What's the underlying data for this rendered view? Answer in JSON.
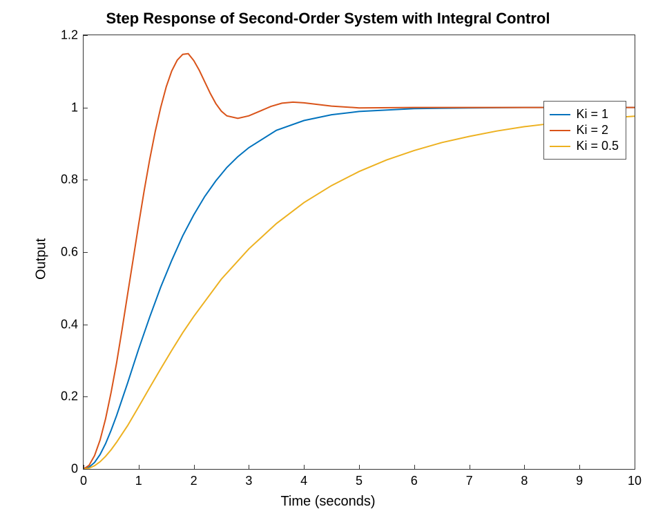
{
  "chart_data": {
    "type": "line",
    "title": "Step Response of Second-Order System with Integral Control",
    "xlabel": "Time (seconds)",
    "ylabel": "Output",
    "xlim": [
      0,
      10
    ],
    "ylim": [
      0,
      1.2
    ],
    "xticks": [
      0,
      1,
      2,
      3,
      4,
      5,
      6,
      7,
      8,
      9,
      10
    ],
    "yticks": [
      0,
      0.2,
      0.4,
      0.6,
      0.8,
      1,
      1.2
    ],
    "legend_position": "upper-right",
    "series": [
      {
        "name": "Ki = 1",
        "color": "#0072BD",
        "x": [
          0,
          0.1,
          0.2,
          0.3,
          0.4,
          0.5,
          0.6,
          0.7,
          0.8,
          0.9,
          1.0,
          1.2,
          1.4,
          1.6,
          1.8,
          2.0,
          2.2,
          2.4,
          2.6,
          2.8,
          3.0,
          3.5,
          4.0,
          4.5,
          5.0,
          6.0,
          7.0,
          8.0,
          9.0,
          10.0
        ],
        "y": [
          0,
          0.005,
          0.018,
          0.04,
          0.07,
          0.107,
          0.148,
          0.193,
          0.238,
          0.285,
          0.332,
          0.42,
          0.503,
          0.577,
          0.645,
          0.703,
          0.754,
          0.797,
          0.834,
          0.864,
          0.889,
          0.937,
          0.964,
          0.98,
          0.989,
          0.997,
          0.999,
          1.0,
          1.0,
          1.0
        ]
      },
      {
        "name": "Ki = 2",
        "color": "#D95319",
        "x": [
          0,
          0.1,
          0.2,
          0.3,
          0.4,
          0.5,
          0.6,
          0.7,
          0.8,
          0.9,
          1.0,
          1.1,
          1.2,
          1.3,
          1.4,
          1.5,
          1.6,
          1.7,
          1.8,
          1.9,
          2.0,
          2.1,
          2.2,
          2.3,
          2.4,
          2.5,
          2.6,
          2.8,
          3.0,
          3.2,
          3.4,
          3.6,
          3.8,
          4.0,
          4.5,
          5.0,
          6.0,
          7.0,
          8.0,
          9.0,
          10.0
        ],
        "y": [
          0,
          0.01,
          0.037,
          0.08,
          0.139,
          0.212,
          0.294,
          0.387,
          0.484,
          0.58,
          0.677,
          0.77,
          0.856,
          0.933,
          1.0,
          1.057,
          1.101,
          1.131,
          1.147,
          1.149,
          1.13,
          1.103,
          1.071,
          1.039,
          1.011,
          0.99,
          0.977,
          0.97,
          0.977,
          0.99,
          1.003,
          1.012,
          1.015,
          1.013,
          1.004,
          0.999,
          1.0,
          1.0,
          1.0,
          1.0,
          1.0
        ]
      },
      {
        "name": "Ki = 0.5",
        "color": "#EDB120",
        "x": [
          0,
          0.1,
          0.2,
          0.3,
          0.4,
          0.5,
          0.6,
          0.8,
          1.0,
          1.2,
          1.4,
          1.6,
          1.8,
          2.0,
          2.5,
          3.0,
          3.5,
          4.0,
          4.5,
          5.0,
          5.5,
          6.0,
          6.5,
          7.0,
          7.5,
          8.0,
          8.5,
          9.0,
          9.5,
          10.0
        ],
        "y": [
          0,
          0.002,
          0.009,
          0.02,
          0.035,
          0.053,
          0.074,
          0.12,
          0.172,
          0.225,
          0.277,
          0.328,
          0.377,
          0.422,
          0.525,
          0.609,
          0.679,
          0.737,
          0.784,
          0.823,
          0.855,
          0.881,
          0.903,
          0.92,
          0.935,
          0.947,
          0.956,
          0.964,
          0.971,
          0.976
        ]
      }
    ]
  }
}
